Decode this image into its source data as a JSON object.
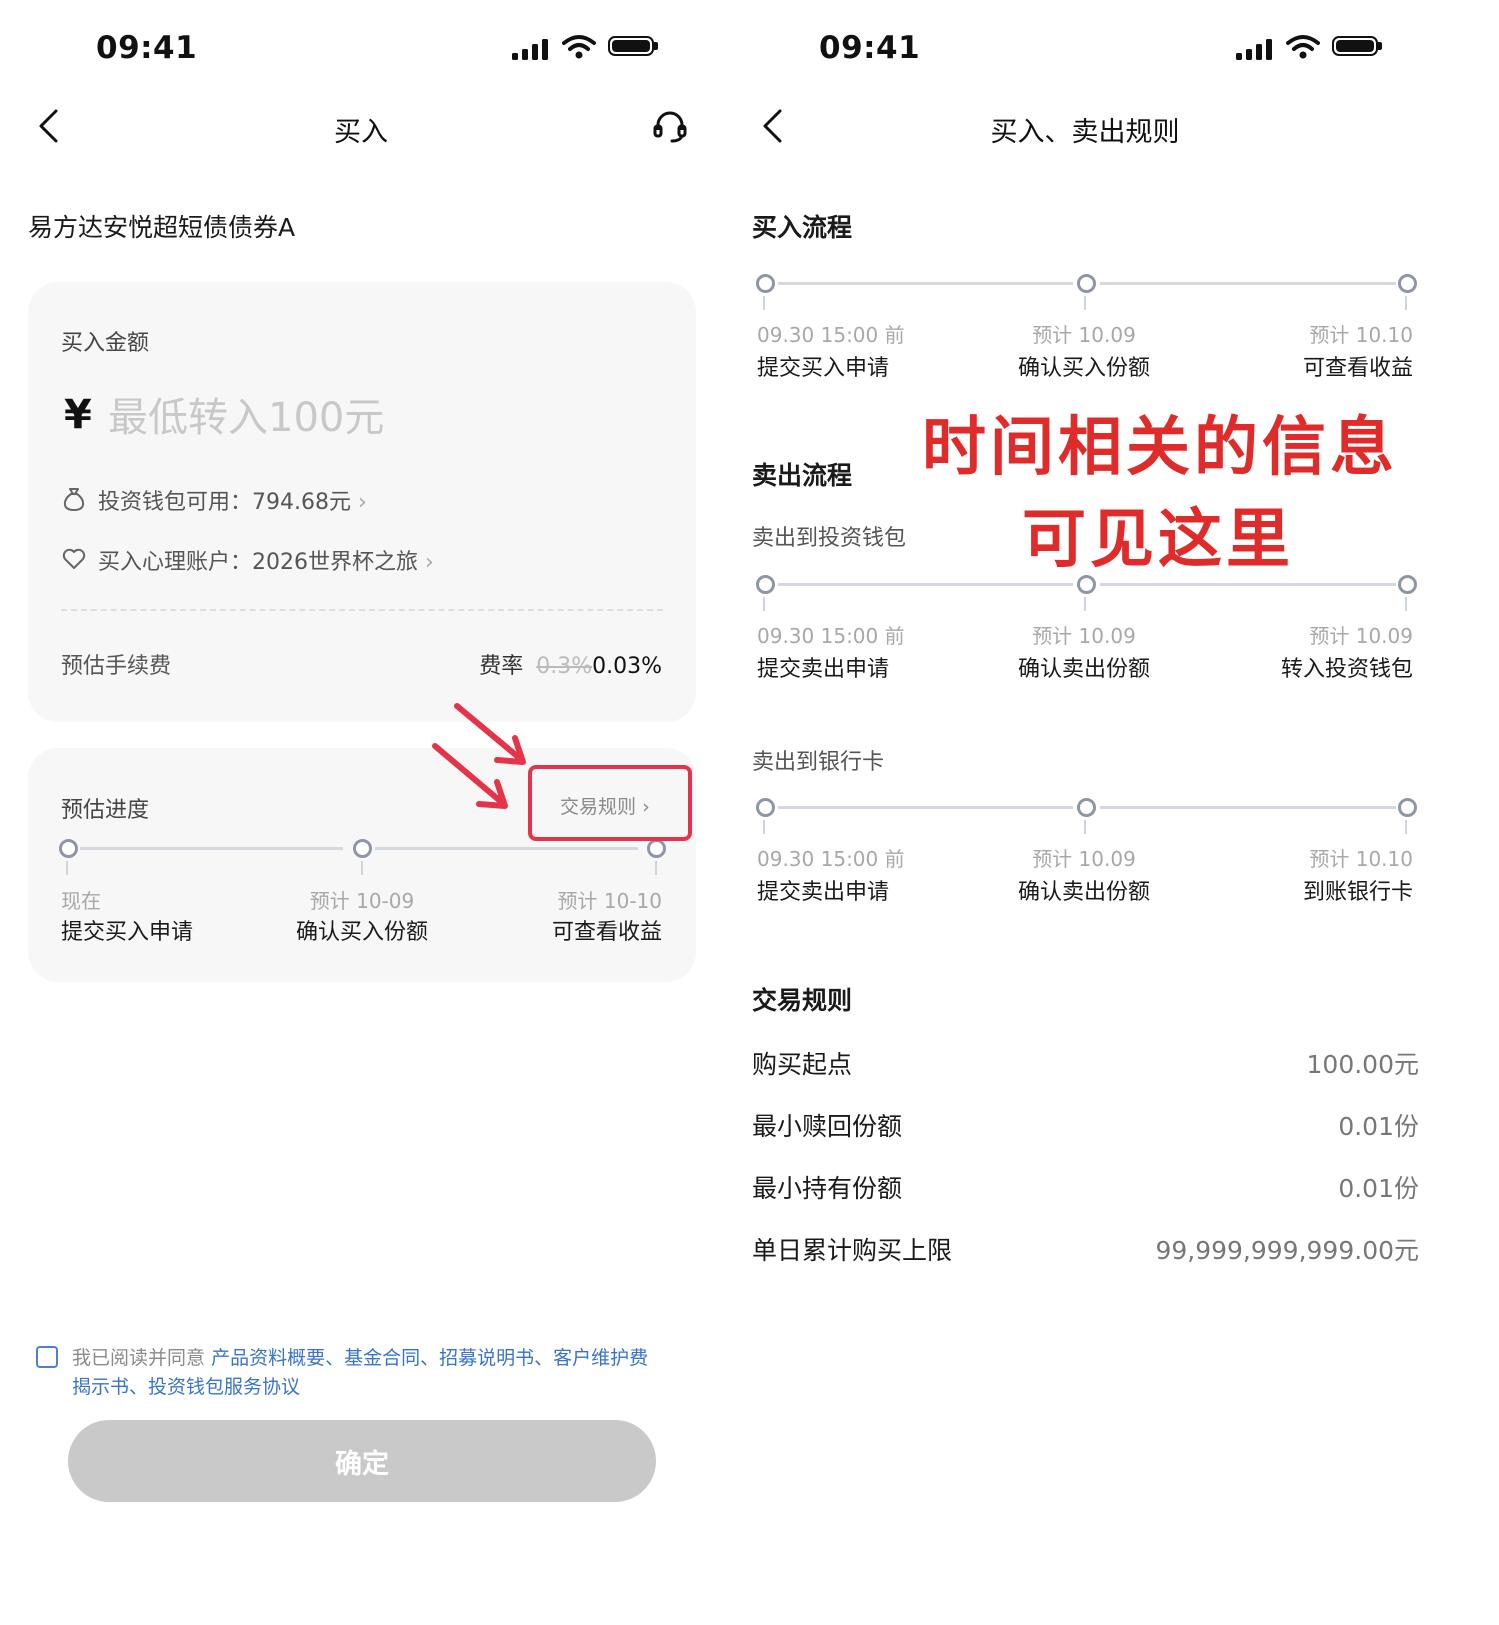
{
  "left": {
    "status": {
      "time": "09:41"
    },
    "nav": {
      "title": "买入"
    },
    "fund_name": "易方达安悦超短债债券A",
    "amount_card": {
      "label": "买入金额",
      "currency": "¥",
      "placeholder": "最低转入100元",
      "wallet_text": "投资钱包可用：794.68元",
      "mind_account_text": "买入心理账户：2026世界杯之旅",
      "fee_label": "预估手续费",
      "fee_rate_label": "费率",
      "fee_old": "0.3%",
      "fee_new": "0.03%"
    },
    "progress_card": {
      "title": "预估进度",
      "rules_link": "交易规则",
      "steps": [
        {
          "time": "现在",
          "label": "提交买入申请"
        },
        {
          "time": "预计 10-09",
          "label": "确认买入份额"
        },
        {
          "time": "预计 10-10",
          "label": "可查看收益"
        }
      ]
    },
    "agreement": {
      "prefix": "我已阅读并同意",
      "line1_links": "产品资料概要、基金合同、招募说明书、客户维护费",
      "line2_links": "揭示书、投资钱包服务协议"
    },
    "confirm_button": "确定"
  },
  "right": {
    "status": {
      "time": "09:41"
    },
    "nav": {
      "title": "买入、卖出规则"
    },
    "buy_section": {
      "title": "买入流程",
      "steps": [
        {
          "time": "09.30 15:00 前",
          "label": "提交买入申请"
        },
        {
          "time": "预计 10.09",
          "label": "确认买入份额"
        },
        {
          "time": "预计 10.10",
          "label": "可查看收益"
        }
      ]
    },
    "sell_section": {
      "title": "卖出流程",
      "wallet_sub": {
        "title": "卖出到投资钱包",
        "steps": [
          {
            "time": "09.30 15:00 前",
            "label": "提交卖出申请"
          },
          {
            "time": "预计 10.09",
            "label": "确认卖出份额"
          },
          {
            "time": "预计 10.09",
            "label": "转入投资钱包"
          }
        ]
      },
      "bank_sub": {
        "title": "卖出到银行卡",
        "steps": [
          {
            "time": "09.30 15:00 前",
            "label": "提交卖出申请"
          },
          {
            "time": "预计 10.09",
            "label": "确认卖出份额"
          },
          {
            "time": "预计 10.10",
            "label": "到账银行卡"
          }
        ]
      }
    },
    "rules": {
      "title": "交易规则",
      "rows": [
        {
          "label": "购买起点",
          "value": "100.00元"
        },
        {
          "label": "最小赎回份额",
          "value": "0.01份"
        },
        {
          "label": "最小持有份额",
          "value": "0.01份"
        },
        {
          "label": "单日累计购买上限",
          "value": "99,999,999,999.00元"
        }
      ]
    }
  },
  "annotation": {
    "line1": "时间相关的信息",
    "line2": "可见这里",
    "color": "#e02b2b"
  }
}
